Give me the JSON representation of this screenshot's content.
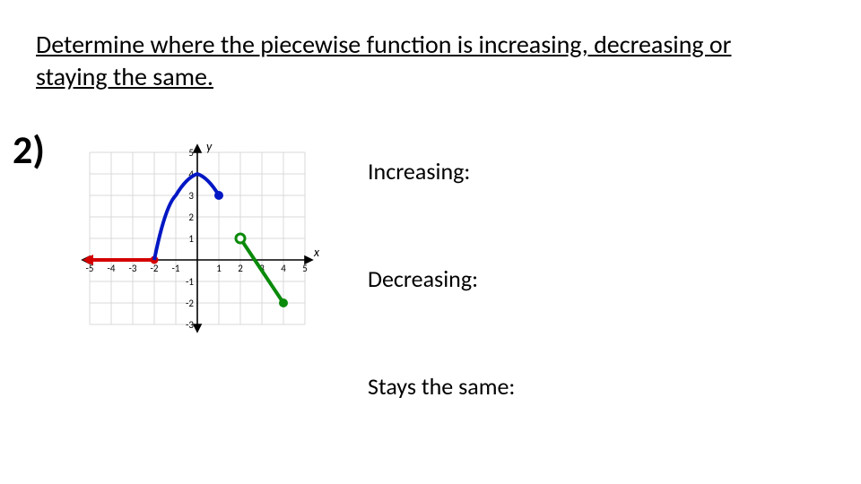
{
  "instruction": "Determine where the piecewise function is increasing, decreasing or staying the same.",
  "question_number": "2)",
  "answers": {
    "increasing_label": "Increasing:",
    "decreasing_label": "Decreasing:",
    "stays_label": "Stays the same:"
  },
  "chart_data": {
    "type": "line",
    "title": "",
    "xlabel": "x",
    "ylabel": "y",
    "xlim": [
      -5,
      5
    ],
    "ylim": [
      -3,
      5
    ],
    "x_ticks": [
      -5,
      -4,
      -3,
      -2,
      -1,
      1,
      2,
      3,
      4,
      5
    ],
    "y_ticks": [
      -3,
      -2,
      -1,
      1,
      2,
      3,
      4,
      5
    ],
    "series": [
      {
        "name": "segment-red-constant",
        "color": "#d40000",
        "open_left_arrow": true,
        "points": [
          {
            "x": -5,
            "y": 0,
            "endpoint": "closed"
          },
          {
            "x": -2,
            "y": 0,
            "endpoint": "closed"
          }
        ]
      },
      {
        "name": "segment-blue-parabola",
        "color": "#0017c4",
        "curve": "parabola",
        "vertex": {
          "x": 0,
          "y": 4
        },
        "points": [
          {
            "x": -2,
            "y": 0,
            "endpoint": "closed"
          },
          {
            "x": 0,
            "y": 4
          },
          {
            "x": 1,
            "y": 3,
            "endpoint": "closed"
          }
        ]
      },
      {
        "name": "segment-green-line",
        "color": "#0a8a0a",
        "points": [
          {
            "x": 2,
            "y": 1,
            "endpoint": "open"
          },
          {
            "x": 4,
            "y": -2,
            "endpoint": "closed"
          }
        ]
      }
    ]
  }
}
